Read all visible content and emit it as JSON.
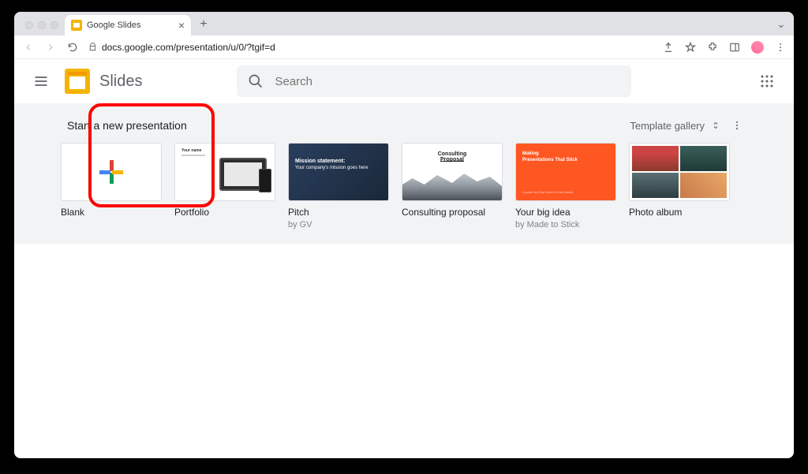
{
  "browser": {
    "tab_title": "Google Slides",
    "url": "docs.google.com/presentation/u/0/?tgif=d"
  },
  "header": {
    "app_name": "Slides",
    "search_placeholder": "Search"
  },
  "templates": {
    "section_title": "Start a new presentation",
    "gallery_label": "Template gallery",
    "items": [
      {
        "title": "Blank",
        "subtitle": ""
      },
      {
        "title": "Portfolio",
        "subtitle": ""
      },
      {
        "title": "Pitch",
        "subtitle": "by GV"
      },
      {
        "title": "Consulting proposal",
        "subtitle": ""
      },
      {
        "title": "Your big idea",
        "subtitle": "by Made to Stick"
      },
      {
        "title": "Photo album",
        "subtitle": ""
      }
    ]
  },
  "thumb_text": {
    "portfolio": "Your name",
    "pitch_bold": "Mission statement:",
    "pitch_rest": "Your company's mission goes here",
    "consulting": "Consulting Proposal",
    "idea_small": "Making",
    "idea_big": "Presentations That Stick",
    "idea_foot": "A guide by Chip Heath & Dan Heath"
  }
}
